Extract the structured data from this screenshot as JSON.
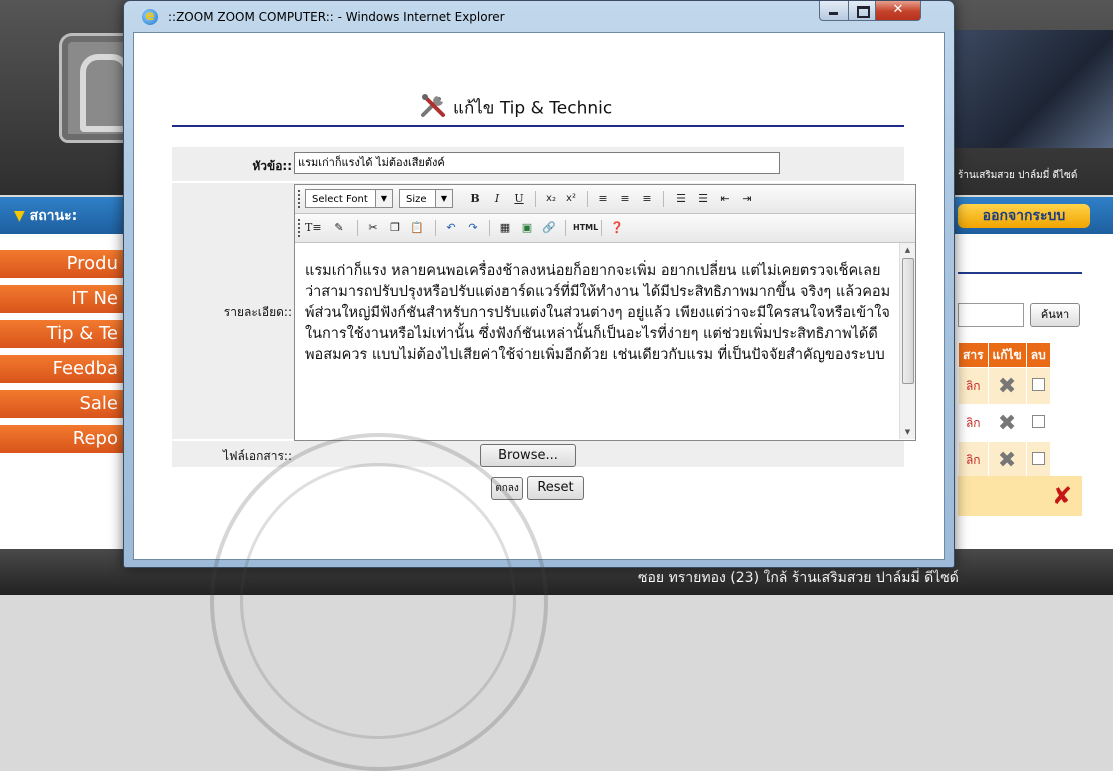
{
  "background_page": {
    "shop_top": "ร้านเสริมสวย ปาล์มมี่ ดีไซด์",
    "status_label": "สถานะ:",
    "logout_button": "ออกจากระบบ",
    "menu": [
      "Produ",
      "IT Ne",
      "Tip & Te",
      "Feedba",
      "Sale",
      "Repo"
    ],
    "search_button": "ค้นหา",
    "table_headers": [
      "สาร",
      "แก้ไข",
      "ลบ"
    ],
    "table_rows": [
      {
        "link": "ลิก"
      },
      {
        "link": "ลิก"
      },
      {
        "link": "ลิก"
      }
    ],
    "footer_address": "ซอย ทรายทอง (23) ใกล้ ร้านเสริมสวย ปาล์มมี่ ดีไซด์"
  },
  "window": {
    "title": "::ZOOM ZOOM COMPUTER:: - Windows Internet Explorer"
  },
  "form": {
    "title": "แก้ไข Tip & Technic",
    "subject_label": "หัวข้อ::",
    "subject_value": "แรมเก่าก็แรงได้ ไม่ต้องเสียตังค์",
    "detail_label": "รายละเอียด::",
    "file_label": "ไฟล์เอกสาร::",
    "browse_label": "Browse...",
    "ok_label": "ตกลง",
    "reset_label": "Reset",
    "editor": {
      "font_select": "Select Font",
      "size_select": "Size",
      "html_button": "HTML",
      "content": "แรมเก่าก็แรง   หลายคนพอเครื่องช้าลงหน่อยก็อยากจะเพิ่ม อยากเปลี่ยน แต่ไม่เคยตรวจเช็คเลยว่าสามารถปรับปรุงหรือปรับแต่งฮาร์ดแวร์ที่มีให้ทำงาน ได้มีประสิทธิภาพมากขึ้น จริงๆ แล้วคอมพ์ส่วนใหญ่มีฟังก์ชันสำหรับการปรับแต่งในส่วนต่างๆ อยู่แล้ว เพียงแต่ว่าจะมีใครสนใจหรือเข้าใจในการใช้งานหรือไม่เท่านั้น ซึ่งฟังก์ชันเหล่านั้นก็เป็นอะไรที่ง่ายๆ แต่ช่วยเพิ่มประสิทธิภาพได้ดีพอสมควร แบบไม่ต้องไปเสียค่าใช้จ่ายเพิ่มอีกด้วย เช่นเดียวกับแรม ที่เป็นปัจจัยสำคัญของระบบ"
    }
  },
  "colors": {
    "accent_orange": "#e96b16",
    "title_rule": "#1f2b8a",
    "nav_blue": "#2f80c8"
  }
}
